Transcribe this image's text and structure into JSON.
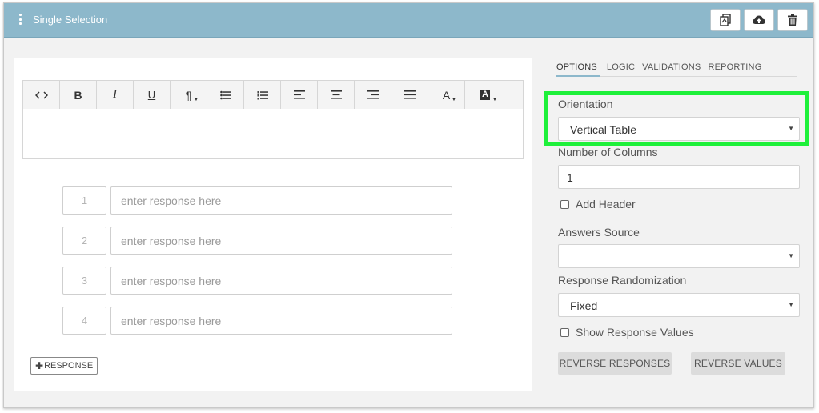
{
  "header": {
    "title": "Single Selection",
    "actions": {
      "copy": "copy-icon",
      "save": "cloud-upload-icon",
      "delete": "trash-icon"
    },
    "background": "#8db8cb"
  },
  "toolbar": {
    "buttons": [
      {
        "name": "code",
        "glyph": "<>"
      },
      {
        "name": "bold",
        "glyph": "B"
      },
      {
        "name": "italic",
        "glyph": "I"
      },
      {
        "name": "underline",
        "glyph": "U"
      },
      {
        "name": "paragraph",
        "glyph": "¶"
      },
      {
        "name": "unordered-list",
        "glyph": ""
      },
      {
        "name": "ordered-list",
        "glyph": ""
      },
      {
        "name": "align-left",
        "glyph": ""
      },
      {
        "name": "align-center",
        "glyph": ""
      },
      {
        "name": "align-right",
        "glyph": ""
      },
      {
        "name": "justify",
        "glyph": ""
      },
      {
        "name": "font-color",
        "glyph": "A"
      },
      {
        "name": "background-color",
        "glyph": "A"
      }
    ]
  },
  "responses": {
    "rows": [
      {
        "number": "1",
        "placeholder": "enter response here"
      },
      {
        "number": "2",
        "placeholder": "enter response here"
      },
      {
        "number": "3",
        "placeholder": "enter response here"
      },
      {
        "number": "4",
        "placeholder": "enter response here"
      }
    ],
    "add_button": "RESPONSE"
  },
  "settings": {
    "tabs": [
      "OPTIONS",
      "LOGIC",
      "VALIDATIONS",
      "REPORTING"
    ],
    "active_tab": "OPTIONS",
    "orientation_label": "Orientation",
    "orientation_value": "Vertical Table",
    "columns_label": "Number of Columns",
    "columns_value": "1",
    "add_header_label": "Add Header",
    "answers_source_label": "Answers Source",
    "answers_source_value": "",
    "randomization_label": "Response Randomization",
    "randomization_value": "Fixed",
    "show_values_label": "Show Response Values",
    "reverse_responses": "REVERSE RESPONSES",
    "reverse_values": "REVERSE VALUES",
    "highlight_color": "#1ef03a"
  }
}
